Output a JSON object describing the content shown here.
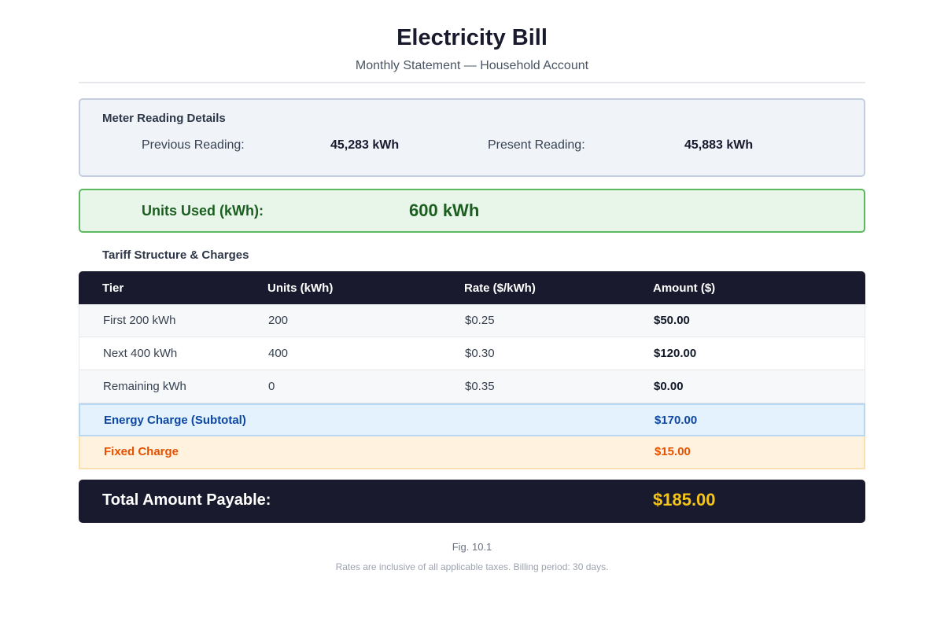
{
  "header": {
    "title": "Electricity Bill",
    "subtitle": "Monthly Statement — Household Account"
  },
  "meter": {
    "heading": "Meter Reading Details",
    "previous_label": "Previous Reading:",
    "previous_value": "45,283 kWh",
    "present_label": "Present Reading:",
    "present_value": "45,883 kWh"
  },
  "units": {
    "label": "Units Used (kWh):",
    "value": "600 kWh"
  },
  "tariff": {
    "heading": "Tariff Structure & Charges",
    "columns": [
      "Tier",
      "Units (kWh)",
      "Rate ($/kWh)",
      "Amount ($)"
    ],
    "rows": [
      {
        "tier": "First 200 kWh",
        "units": "200",
        "rate": "$0.25",
        "amount": "$50.00"
      },
      {
        "tier": "Next 400 kWh",
        "units": "400",
        "rate": "$0.30",
        "amount": "$120.00"
      },
      {
        "tier": "Remaining kWh",
        "units": "0",
        "rate": "$0.35",
        "amount": "$0.00"
      }
    ],
    "subtotal": {
      "label": "Energy Charge (Subtotal)",
      "amount": "$170.00"
    },
    "fixed": {
      "label": "Fixed Charge",
      "amount": "$15.00"
    }
  },
  "total": {
    "label": "Total Amount Payable:",
    "value": "$185.00"
  },
  "footer": {
    "caption": "Fig. 10.1",
    "note": "Rates are inclusive of all applicable taxes. Billing period: 30 days."
  },
  "colors": {
    "header_dark": "#1a1a2e",
    "units_green": "#1b5e20",
    "subtotal_blue": "#0d47a1",
    "fixed_orange": "#e65100",
    "total_gold": "#f5c518"
  }
}
